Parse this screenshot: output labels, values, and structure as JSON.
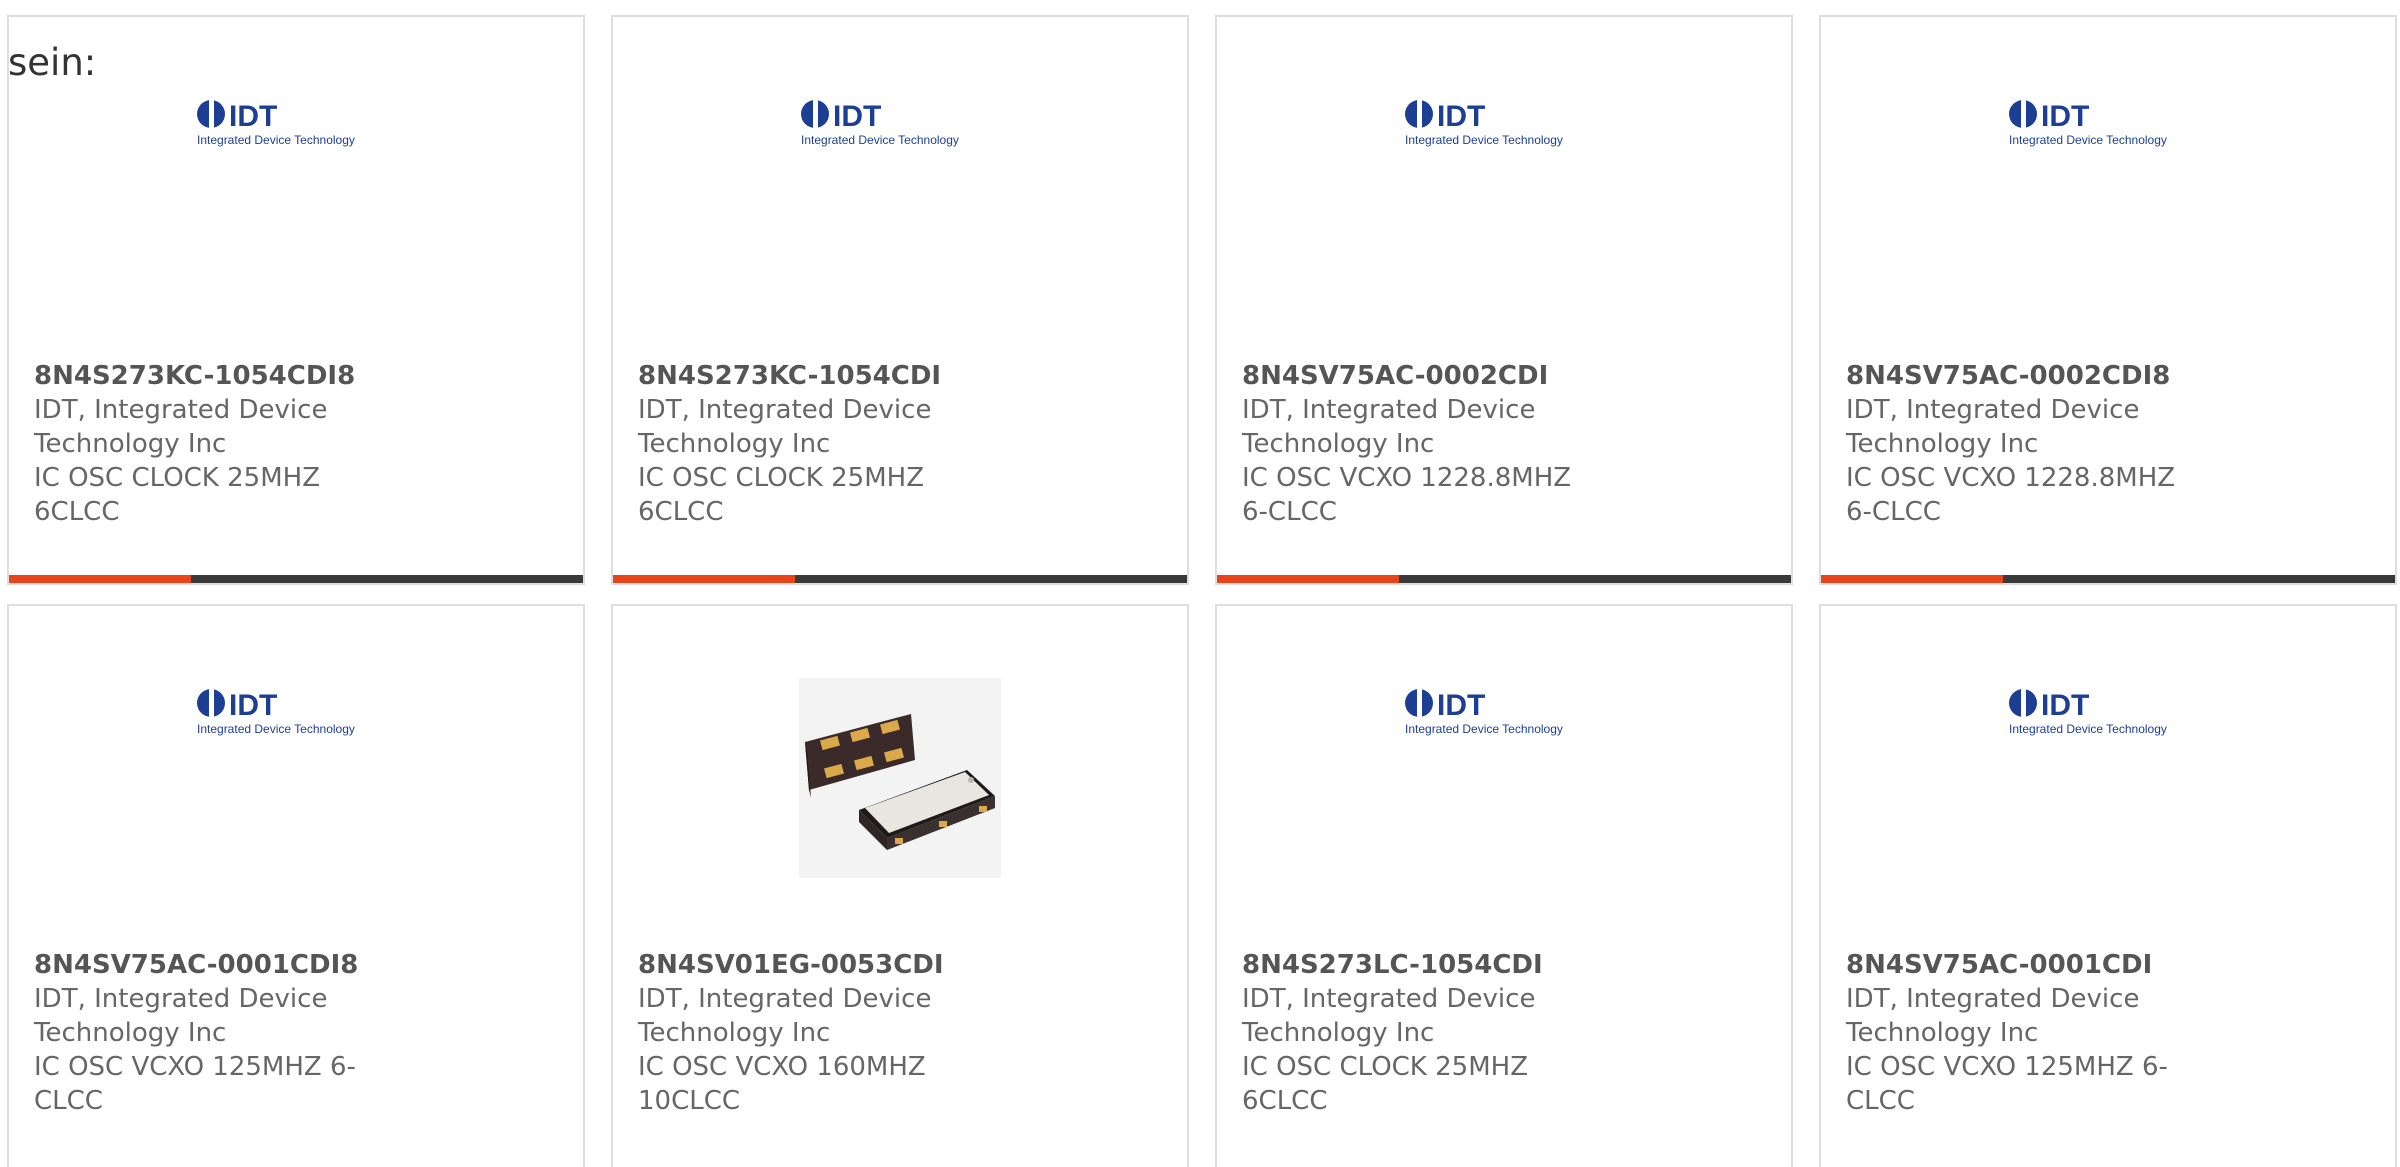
{
  "intro_text": "sein:",
  "colors": {
    "accent_orange": "#e8441b",
    "accent_dark": "#3a3a3a",
    "idt_blue": "#1c3f94"
  },
  "logo": {
    "brand": "IDT",
    "tagline": "Integrated Device Technology"
  },
  "products": [
    {
      "part": "8N4S273KC-1054CDI8",
      "mfr": "IDT, Integrated Device Technology Inc",
      "desc": "IC OSC CLOCK 25MHZ 6CLCC",
      "image": "idt-logo"
    },
    {
      "part": "8N4S273KC-1054CDI",
      "mfr": "IDT, Integrated Device Technology Inc",
      "desc": "IC OSC CLOCK 25MHZ 6CLCC",
      "image": "idt-logo"
    },
    {
      "part": "8N4SV75AC-0002CDI",
      "mfr": "IDT, Integrated Device Technology Inc",
      "desc": "IC OSC VCXO 1228.8MHZ 6-CLCC",
      "image": "idt-logo"
    },
    {
      "part": "8N4SV75AC-0002CDI8",
      "mfr": "IDT, Integrated Device Technology Inc",
      "desc": "IC OSC VCXO 1228.8MHZ 6-CLCC",
      "image": "idt-logo"
    },
    {
      "part": "8N4SV75AC-0001CDI8",
      "mfr": "IDT, Integrated Device Technology Inc",
      "desc": "IC OSC VCXO 125MHZ 6-CLCC",
      "image": "idt-logo"
    },
    {
      "part": "8N4SV01EG-0053CDI",
      "mfr": "IDT, Integrated Device Technology Inc",
      "desc": "IC OSC VCXO 160MHZ 10CLCC",
      "image": "oscillator-package"
    },
    {
      "part": "8N4S273LC-1054CDI",
      "mfr": "IDT, Integrated Device Technology Inc",
      "desc": "IC OSC CLOCK 25MHZ 6CLCC",
      "image": "idt-logo"
    },
    {
      "part": "8N4SV75AC-0001CDI",
      "mfr": "IDT, Integrated Device Technology Inc",
      "desc": "IC OSC VCXO 125MHZ 6-CLCC",
      "image": "idt-logo"
    }
  ]
}
